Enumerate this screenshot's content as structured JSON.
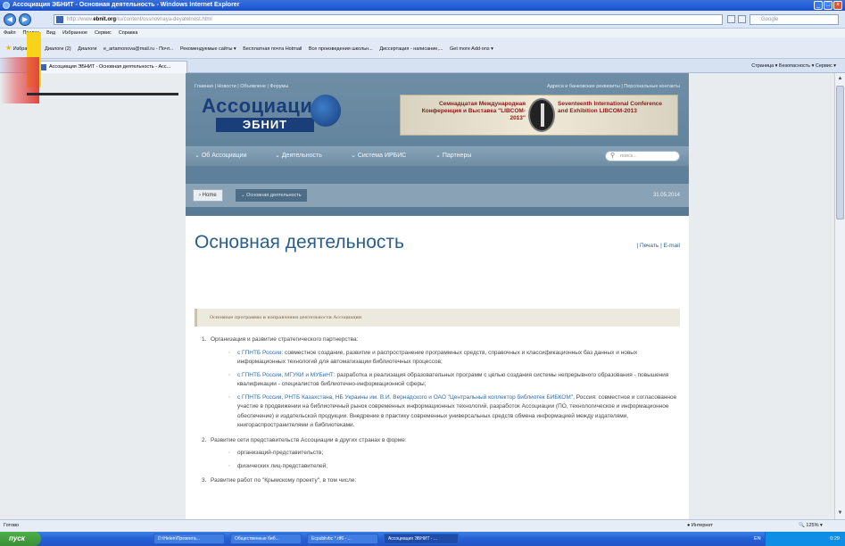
{
  "window": {
    "title": "Ассоциация ЭБНИТ - Основная деятельность - Windows Internet Explorer"
  },
  "address_bar": {
    "url_domain": "ebnit.org",
    "url_prefix": "http://www.",
    "url_rest": "/ru/content/ossnovnaya-deyatelnost.html",
    "search_placeholder": "Google"
  },
  "menu": [
    "Файл",
    "Правка",
    "Вид",
    "Избранное",
    "Сервис",
    "Справка"
  ],
  "favorites": [
    "Избранное",
    "Диалоги (2)",
    "Диалоги",
    "e_artamonova@mail.ru - Почт...",
    "Рекомендуемые сайты ▾",
    "Бесплатная почта Hotmail",
    "Все произведения школьн...",
    "Диссертация - написание,...",
    "Get more Add-ons ▾"
  ],
  "tab": {
    "label": "Ассоциация ЭБНИТ - Основная деятельность - Асс..."
  },
  "command_bar": "Страница ▾   Безопасность ▾   Сервис ▾",
  "site": {
    "toplinks_left": "Главная  |  Новости  |  Объявлене  |  Форумы",
    "toplinks_right": "Адреса и банковские реквизиты  |  Персональные контакты",
    "logo_title": "Ассоциация",
    "logo_sub": "ЭБНИТ",
    "banner_ru": "Семнадцатая Международная Конференция и Выставка \"LIBCOM-2013\"",
    "banner_en": "Seventeenth International Conference and Exhibition LIBCOM-2013",
    "nav": [
      "Об Ассоциации",
      "Деятельность",
      "Система ИРБИС",
      "Партнеры"
    ],
    "search_placeholder": "поиск...",
    "breadcrumb_home": "Home",
    "breadcrumb_current": "Основная деятельность",
    "date": "31.05.2014"
  },
  "content": {
    "heading": "Основная деятельность",
    "print_links": "| Печать |  E-mail",
    "section_title": "Основные программы и направления деятельности Ассоциации",
    "items": [
      {
        "num": "1.",
        "text": "Организация и развитие стратегического партнерства:",
        "subs": [
          {
            "link": "с ГПНТБ России:",
            "text": " совместное создание, развитие и распространение программных средств, справочных и классификационных баз данных и новых информационных технологий для автоматизации библиотечных процессов;"
          },
          {
            "link": "с ГПНТБ России, МГУКИ и МУБиНТ:",
            "text": " разработка и реализация образовательных программ с целью создания системы непрерывного образования - повышения квалификации - специалистов библиотечно-информационной сферы;"
          },
          {
            "link": "с ГПНТБ России, РНТБ Казахстана, НБ Украины им. В.И. Вернадского и ОАО \"Центральный коллектор библиотек БИБКОМ\"",
            "text": ", Россия: совместное и согласованное участие в продвижении на библиотечный рынок современных информационных технологий, разработок Ассоциации (ПО, технологическое и информационное обеспечение) и издательской продукции. Внедрение в практику современных универсальных средств обмена информацией между издателями, книгораспространителями и библиотеками."
          }
        ]
      },
      {
        "num": "2.",
        "text": "Развитие сети представительств Ассоциации в других странах в форме:",
        "subs": [
          {
            "link": "",
            "text": "организаций-представительств;"
          },
          {
            "link": "",
            "text": "физических лиц-представителей;"
          }
        ]
      },
      {
        "num": "3.",
        "text": "Развитие работ по \"Крымскому проекту\", в том числе:",
        "subs": []
      }
    ]
  },
  "statusbar": {
    "left": "Готово",
    "zone": "Интернет",
    "zoom": "125%"
  },
  "taskbar": {
    "start": "пуск",
    "items": [
      "D:\\Helen\\Презента...",
      "Общественные биб...",
      "Ecpublivbc *.rtf6 - ...",
      "Ассоциация ЭБНИТ - ..."
    ],
    "lang": "EN",
    "time": "0:29"
  }
}
